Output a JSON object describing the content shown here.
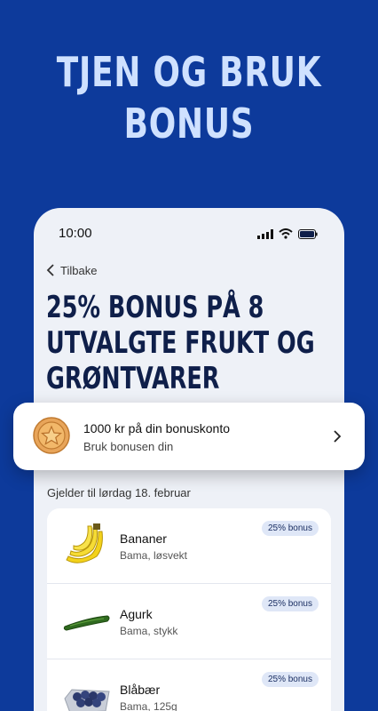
{
  "promo": {
    "line1": "TJEN OG BRUK",
    "line2": "BONUS"
  },
  "status": {
    "time": "10:00"
  },
  "nav": {
    "back_label": "Tilbake"
  },
  "offer": {
    "title_line1": "25% BONUS PÅ 8",
    "title_line2": "UTVALGTE FRUKT OG",
    "title_line3": "GRØNTVARER"
  },
  "bonus_card": {
    "amount": "1000 kr på din bonuskonto",
    "subtitle": "Bruk bonusen din"
  },
  "valid_until": "Gjelder til lørdag 18. februar",
  "products": [
    {
      "name": "Bananer",
      "desc": "Bama, løsvekt",
      "badge": "25% bonus",
      "icon": "banana-icon"
    },
    {
      "name": "Agurk",
      "desc": "Bama, stykk",
      "badge": "25% bonus",
      "icon": "cucumber-icon"
    },
    {
      "name": "Blåbær",
      "desc": "Bama, 125g",
      "badge": "25% bonus",
      "icon": "blueberries-icon"
    }
  ],
  "colors": {
    "background": "#0d3a9b",
    "title": "#cfe1ff",
    "badge_bg": "#dfe7f7"
  }
}
